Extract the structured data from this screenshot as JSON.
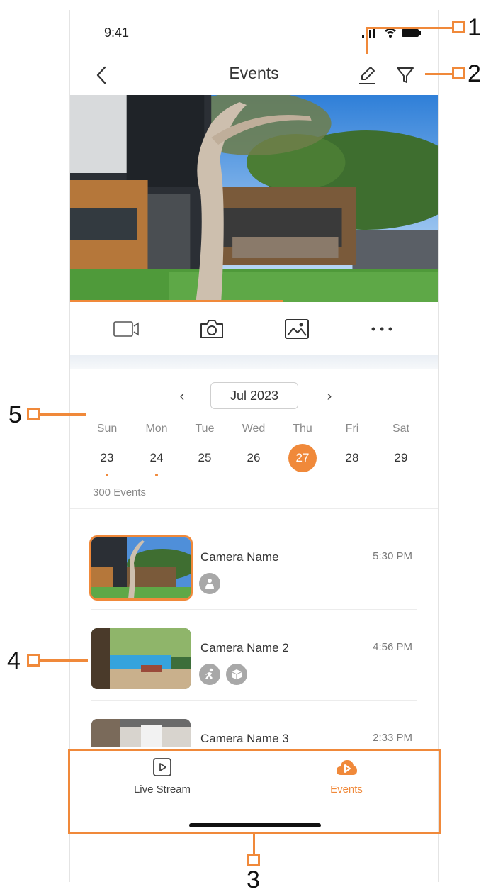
{
  "status_bar": {
    "time": "9:41"
  },
  "nav": {
    "title": "Events"
  },
  "calendar": {
    "month_label": "Jul 2023",
    "weekdays": [
      "Sun",
      "Mon",
      "Tue",
      "Wed",
      "Thu",
      "Fri",
      "Sat"
    ],
    "dates": [
      {
        "day": "23",
        "has_events": true
      },
      {
        "day": "24",
        "has_events": true
      },
      {
        "day": "25",
        "has_events": false
      },
      {
        "day": "26",
        "has_events": false
      },
      {
        "day": "27",
        "has_events": false,
        "selected": true
      },
      {
        "day": "28",
        "has_events": false
      },
      {
        "day": "29",
        "has_events": false
      }
    ]
  },
  "events_count": "300 Events",
  "events": [
    {
      "camera": "Camera Name",
      "time": "5:30 PM",
      "badges": [
        "person-icon"
      ],
      "active": true
    },
    {
      "camera": "Camera Name 2",
      "time": "4:56 PM",
      "badges": [
        "running-person-icon",
        "package-icon"
      ],
      "active": false
    },
    {
      "camera": "Camera Name 3",
      "time": "2:33 PM",
      "badges": [],
      "active": false
    }
  ],
  "tabs": [
    {
      "label": "Live Stream",
      "icon": "play-square-icon",
      "active": false
    },
    {
      "label": "Events",
      "icon": "cloud-play-icon",
      "active": true
    }
  ],
  "annotations": [
    "1",
    "2",
    "3",
    "4",
    "5"
  ],
  "colors": {
    "accent": "#f0893a",
    "text": "#333333",
    "muted": "#8a8a8a"
  }
}
